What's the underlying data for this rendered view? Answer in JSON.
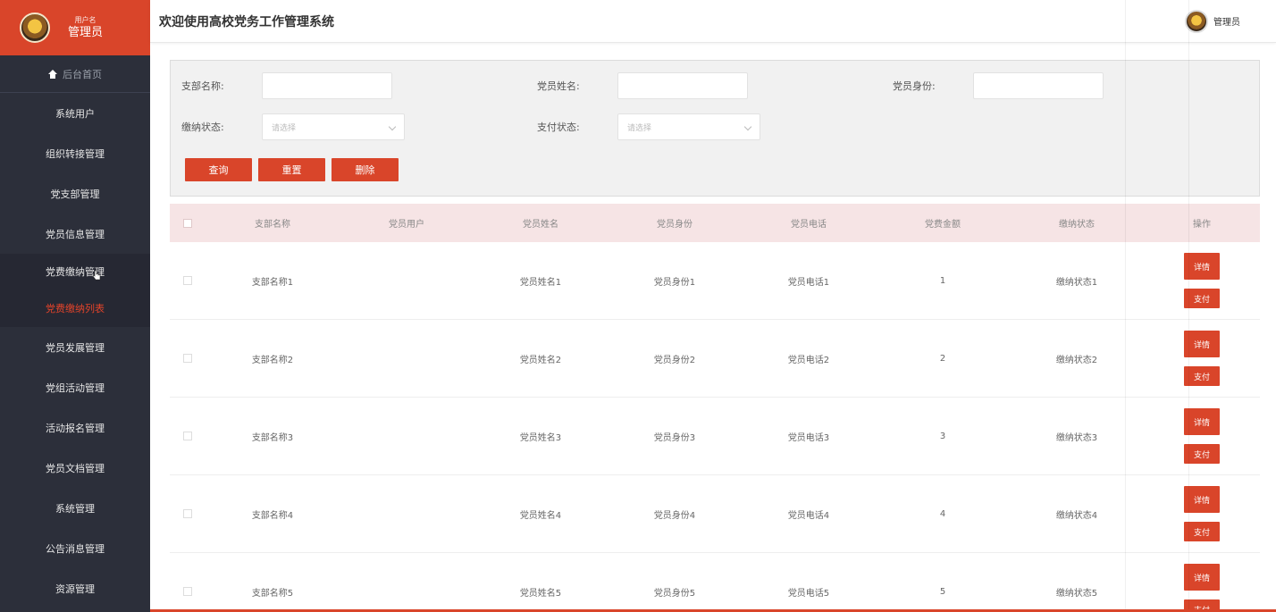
{
  "sidebar": {
    "user_small": "用户名",
    "user_name": "管理员",
    "home": "后台首页",
    "items": [
      "系统用户",
      "组织转接管理",
      "党支部管理",
      "党员信息管理",
      "党费缴纳管理"
    ],
    "sub_active": "党费缴纳列表",
    "items_after": [
      "党员发展管理",
      "党组活动管理",
      "活动报名管理",
      "党员文档管理",
      "系统管理",
      "公告消息管理",
      "资源管理"
    ]
  },
  "header": {
    "title": "欢迎使用高校党务工作管理系统",
    "admin": "管理员"
  },
  "filters": {
    "branch_label": "支部名称:",
    "member_name_label": "党员姓名:",
    "member_identity_label": "党员身份:",
    "pay_status_label": "缴纳状态:",
    "payment_state_label": "支付状态:",
    "select_placeholder": "请选择",
    "query_btn": "查询",
    "reset_btn": "重置",
    "delete_btn": "删除"
  },
  "table": {
    "headers": [
      "支部名称",
      "党员用户",
      "党员姓名",
      "党员身份",
      "党员电话",
      "党费金额",
      "缴纳状态",
      "操作"
    ],
    "detail_btn": "详情",
    "pay_btn": "支付",
    "rows": [
      {
        "branch": "支部名称1",
        "user": "",
        "name": "党员姓名1",
        "identity": "党员身份1",
        "phone": "党员电话1",
        "amount": "1",
        "status": "缴纳状态1"
      },
      {
        "branch": "支部名称2",
        "user": "",
        "name": "党员姓名2",
        "identity": "党员身份2",
        "phone": "党员电话2",
        "amount": "2",
        "status": "缴纳状态2"
      },
      {
        "branch": "支部名称3",
        "user": "",
        "name": "党员姓名3",
        "identity": "党员身份3",
        "phone": "党员电话3",
        "amount": "3",
        "status": "缴纳状态3"
      },
      {
        "branch": "支部名称4",
        "user": "",
        "name": "党员姓名4",
        "identity": "党员身份4",
        "phone": "党员电话4",
        "amount": "4",
        "status": "缴纳状态4"
      },
      {
        "branch": "支部名称5",
        "user": "",
        "name": "党员姓名5",
        "identity": "党员身份5",
        "phone": "党员电话5",
        "amount": "5",
        "status": "缴纳状态5"
      }
    ]
  },
  "colors": {
    "accent": "#d9452a",
    "sidebar_bg": "#2c2f3a",
    "table_head_bg": "#f6e4e5"
  }
}
